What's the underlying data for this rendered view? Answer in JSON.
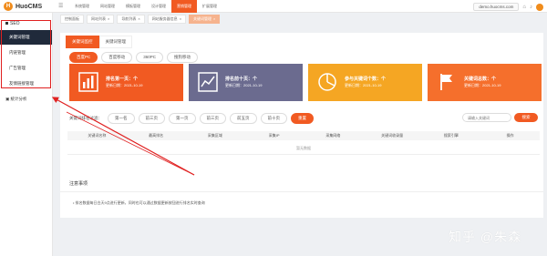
{
  "header": {
    "logo_text": "HuoCMS",
    "nav": [
      "系统管理",
      "网站管理",
      "模板管理",
      "设计管理",
      "营销管理",
      "扩展管理"
    ],
    "domain": "demo.huocms.com"
  },
  "breadcrumbs": [
    "控制面板",
    "网站列表",
    "导航列表",
    "网站服务器信息",
    "关键词管理"
  ],
  "sidebar": {
    "group_label": "SEO",
    "items": [
      "关键词管理",
      "内链管理",
      "广告管理",
      "友情链接管理"
    ],
    "stat_label": "统计分析"
  },
  "panel": {
    "subtabs": [
      "关键词监控",
      "关键词管理"
    ],
    "engines": [
      "百度PC",
      "百度移动",
      "360PC",
      "搜狗移动"
    ]
  },
  "cards": [
    {
      "title": "排名第一页：个",
      "date": "更新日期：2021-10-19",
      "color": "#f15a22",
      "icon": "chart-bars-icon"
    },
    {
      "title": "排名前十页：个",
      "date": "更新日期：2021-10-19",
      "color": "#6b6b8f",
      "icon": "chart-line-icon"
    },
    {
      "title": "参与关键词个数：个",
      "date": "更新日期：2021-10-19",
      "color": "#f5a623",
      "icon": "pie-chart-icon"
    },
    {
      "title": "关键词总数：个",
      "date": "更新日期：2021-10-19",
      "color": "#f56f2c",
      "icon": "flag-icon"
    }
  ],
  "filter": {
    "label": "关键词排名过滤：",
    "options": [
      "第一名",
      "前三页",
      "第一页",
      "前三页",
      "前五页",
      "前十页"
    ],
    "reset": "重置",
    "search_placeholder": "请输入关键词",
    "search_button": "搜索"
  },
  "table": {
    "columns": [
      "关键词名称",
      "最高排名",
      "采集区域",
      "采集IP",
      "采集网络",
      "关键词收录量",
      "搜索引擎",
      "操作"
    ],
    "empty": "暂无数据"
  },
  "notes": {
    "title": "注意事项",
    "body": "• 排名数据每日白天9点进行更新，同时也可以通过数据更新按钮进行排名实时查询"
  },
  "watermark": "知乎 @朱森",
  "colors": {
    "accent": "#f15a22",
    "sidebar_active": "#202a3b",
    "annotation": "#e02020"
  }
}
